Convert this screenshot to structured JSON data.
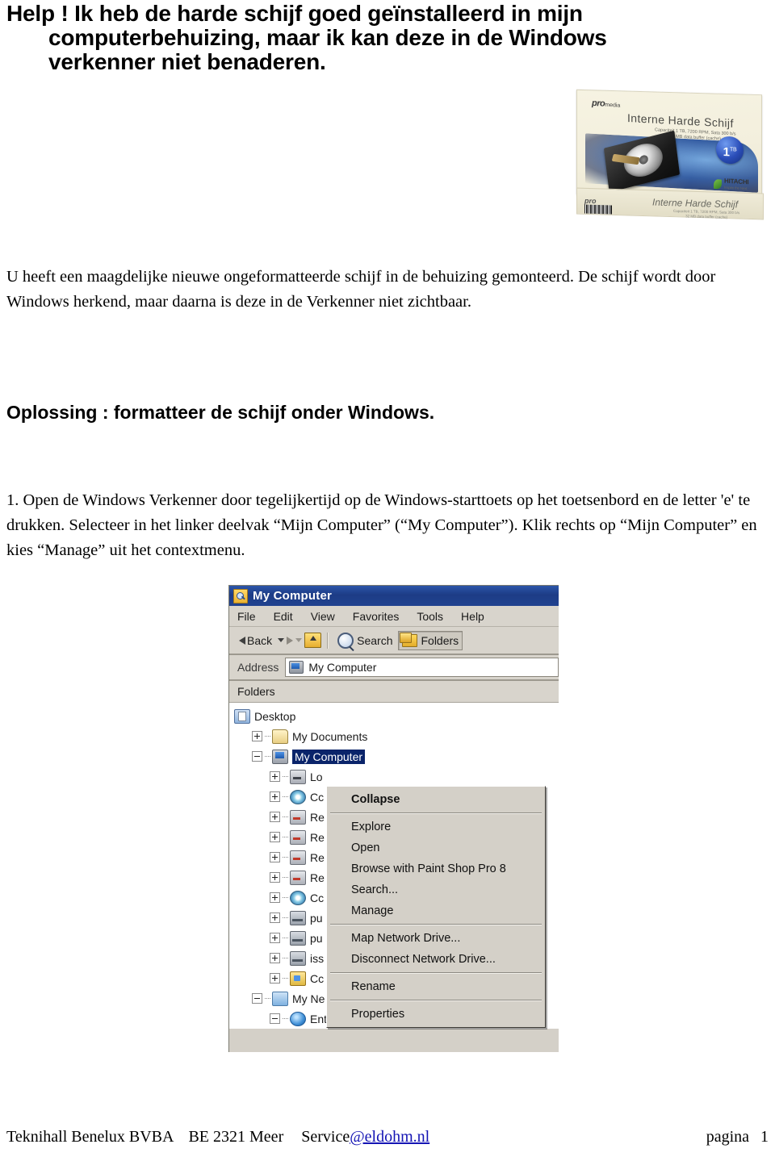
{
  "document": {
    "title_lines": [
      "Help ! Ik heb de harde schijf goed geïnstalleerd in mijn",
      "computerbehuizing, maar ik kan deze in de Windows",
      "verkenner niet benaderen."
    ],
    "intro_paragraph": "U heeft een maagdelijke nieuwe ongeformatteerde schijf in de behuizing gemonteerd. De schijf wordt door Windows herkend, maar daarna is deze in de Verkenner niet zichtbaar.",
    "section_heading": "Oplossing : formatteer de schijf onder Windows.",
    "step_paragraph": "1. Open de Windows Verkenner door tegelijkertijd op de Windows-starttoets op het toetsenbord en de letter 'e' te drukken. Selecteer in het linker deelvak “Mijn Computer” (“My Computer”). Klik rechts op “Mijn Computer” en kies “Manage” uit het contextmenu."
  },
  "product_photo": {
    "brand": "pro",
    "brand_suffix": "media",
    "box_title": "Interne Harde Schijf",
    "box_subtitle_line1": "Capaciteit 1 TB, 7200 RPM, Sata 300 b/s",
    "box_subtitle_line2": "32 MB data buffer (cache)",
    "capacity_value": "1",
    "capacity_unit": "TB",
    "manufacturer": "HITACHI",
    "manufacturer_tagline": "Inspire the Next",
    "side_title": "Interne Harde Schijf",
    "side_subtitle_line1": "Capaciteit 1 TB, 7200 RPM, Sata 300 b/s",
    "side_subtitle_line2": "32 MB data buffer (cache)"
  },
  "explorer": {
    "window_title": "My Computer",
    "menu_items": [
      "File",
      "Edit",
      "View",
      "Favorites",
      "Tools",
      "Help"
    ],
    "toolbar": {
      "back_label": "Back",
      "search_label": "Search",
      "folders_label": "Folders"
    },
    "address": {
      "label": "Address",
      "value": "My Computer"
    },
    "folders_pane_header": "Folders",
    "tree": [
      {
        "label": "Desktop",
        "icon": "desktop-icon",
        "indent": 0,
        "expander": "none",
        "selected": false
      },
      {
        "label": "My Documents",
        "icon": "documents-icon",
        "indent": 1,
        "expander": "plus",
        "selected": false
      },
      {
        "label": "My Computer",
        "icon": "computer-icon",
        "indent": 1,
        "expander": "minus",
        "selected": true
      },
      {
        "label": "Lo",
        "icon": "drive-icon",
        "indent": 2,
        "expander": "plus",
        "selected": false
      },
      {
        "label": "Cc",
        "icon": "cd-drive-icon",
        "indent": 2,
        "expander": "plus",
        "selected": false
      },
      {
        "label": "Re",
        "icon": "removable-icon",
        "indent": 2,
        "expander": "plus",
        "selected": false
      },
      {
        "label": "Re",
        "icon": "removable-icon",
        "indent": 2,
        "expander": "plus",
        "selected": false
      },
      {
        "label": "Re",
        "icon": "removable-icon",
        "indent": 2,
        "expander": "plus",
        "selected": false
      },
      {
        "label": "Re",
        "icon": "removable-icon",
        "indent": 2,
        "expander": "plus",
        "selected": false
      },
      {
        "label": "Cc",
        "icon": "cd-drive-icon",
        "indent": 2,
        "expander": "plus",
        "selected": false
      },
      {
        "label": "pu",
        "icon": "network-drive-icon",
        "indent": 2,
        "expander": "plus",
        "selected": false
      },
      {
        "label": "pu",
        "icon": "network-drive-icon",
        "indent": 2,
        "expander": "plus",
        "selected": false
      },
      {
        "label": "iss",
        "icon": "network-drive-icon",
        "indent": 2,
        "expander": "plus",
        "selected": false
      },
      {
        "label": "Cc",
        "icon": "network-folder-icon",
        "indent": 2,
        "expander": "plus",
        "selected": false
      },
      {
        "label": "My Ne",
        "icon": "my-network-icon",
        "indent": 1,
        "expander": "minus",
        "selected": false
      },
      {
        "label": "Entire Network",
        "icon": "globe-icon",
        "indent": 2,
        "expander": "minus",
        "selected": false
      }
    ],
    "context_menu": [
      {
        "label": "Collapse",
        "bold": true,
        "separator_after": true
      },
      {
        "label": "Explore",
        "bold": false,
        "separator_after": false
      },
      {
        "label": "Open",
        "bold": false,
        "separator_after": false
      },
      {
        "label": "Browse with Paint Shop Pro 8",
        "bold": false,
        "separator_after": false
      },
      {
        "label": "Search...",
        "bold": false,
        "separator_after": false
      },
      {
        "label": "Manage",
        "bold": false,
        "separator_after": true
      },
      {
        "label": "Map Network Drive...",
        "bold": false,
        "separator_after": false
      },
      {
        "label": "Disconnect Network Drive...",
        "bold": false,
        "separator_after": true
      },
      {
        "label": "Rename",
        "bold": false,
        "separator_after": true
      },
      {
        "label": "Properties",
        "bold": false,
        "separator_after": false
      }
    ]
  },
  "footer": {
    "company": "Teknihall Benelux BVBA",
    "vat": "BE 2321 Meer",
    "service_prefix": "Service",
    "service_mail": "@eldohm.nl",
    "page_label": "pagina",
    "page_number": "1"
  },
  "colors": {
    "titlebar": "#1d3c86",
    "selection": "#0a246a",
    "window_face": "#d4d0c8",
    "link": "#1414b4"
  }
}
